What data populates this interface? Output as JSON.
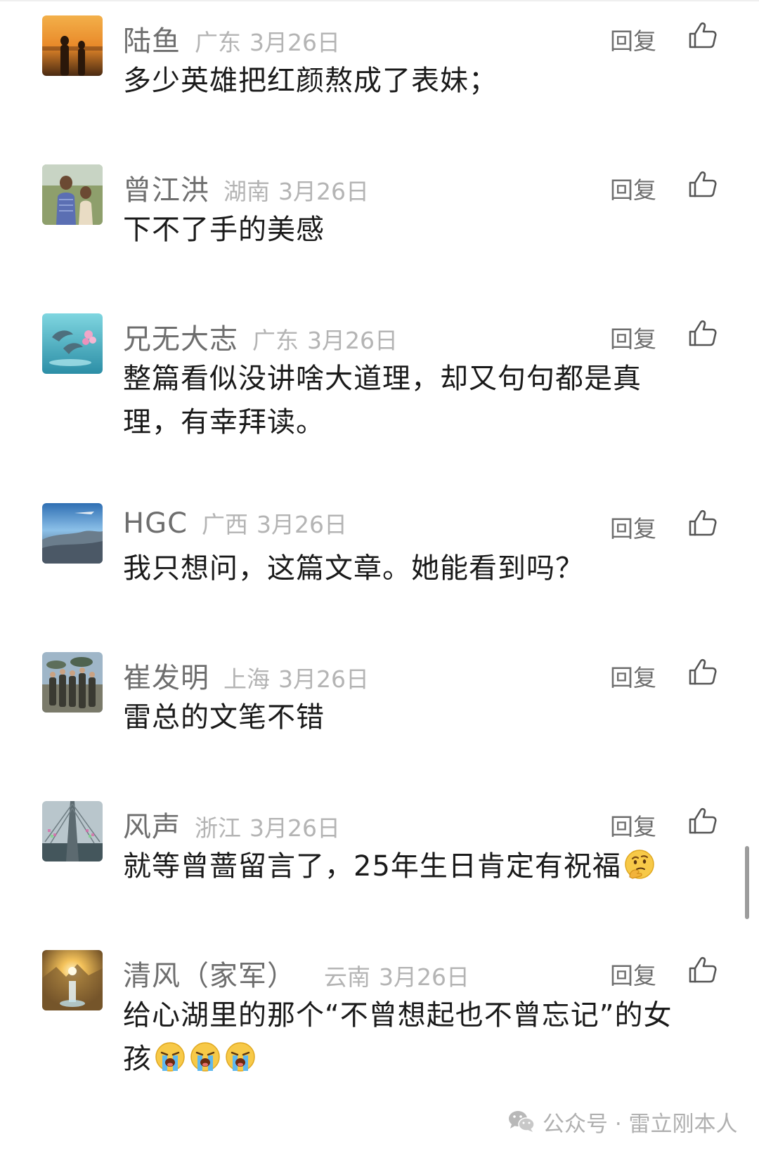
{
  "reply_label": "回复",
  "comments": [
    {
      "nickname": "陆鱼",
      "location": "广东",
      "date": "3月26日",
      "lines": [
        "多少英雄把红颜熬成了表妹；"
      ]
    },
    {
      "nickname": "曾江洪",
      "location": "湖南",
      "date": "3月26日",
      "lines": [
        "下不了手的美感"
      ]
    },
    {
      "nickname": "兄无大志",
      "location": "广东",
      "date": "3月26日",
      "lines": [
        "整篇看似没讲啥大道理，却又句句都是真",
        "理，有幸拜读。"
      ]
    },
    {
      "nickname": "HGC",
      "location": "广西",
      "date": "3月26日",
      "lines": [
        "我只想问，这篇文章。她能看到吗？"
      ]
    },
    {
      "nickname": "崔发明",
      "location": "上海",
      "date": "3月26日",
      "lines": [
        "雷总的文笔不错"
      ]
    },
    {
      "nickname": "风声",
      "location": "浙江",
      "date": "3月26日",
      "lines": [
        "就等曾蔷留言了，25年生日肯定有祝福"
      ],
      "emoji": "thinking-face"
    },
    {
      "nickname": "清风（家军）",
      "location": "云南",
      "date": "3月26日",
      "lines": [
        "给心湖里的那个“不曾想起也不曾忘记”的女",
        "孩"
      ],
      "emoji_end": [
        "crying-face",
        "crying-face",
        "crying-face"
      ]
    }
  ],
  "watermark": {
    "icon": "wechat-icon",
    "text": "公众号 · 雷立刚本人"
  },
  "colors": {
    "name": "#6e6e6e",
    "meta": "#b4b4b4",
    "text": "#1a1a1a",
    "scrollbar": "#9c9c9c"
  }
}
